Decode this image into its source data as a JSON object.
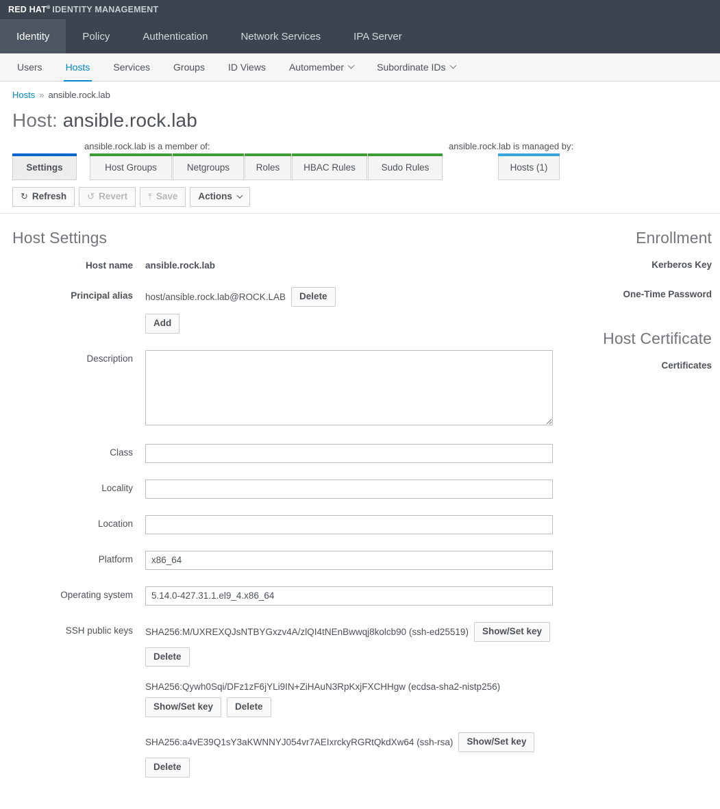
{
  "brand": {
    "vendor": "RED HAT",
    "registered": "®",
    "product": "IDENTITY MANAGEMENT"
  },
  "primary_nav": [
    {
      "label": "Identity",
      "active": true
    },
    {
      "label": "Policy",
      "active": false
    },
    {
      "label": "Authentication",
      "active": false
    },
    {
      "label": "Network Services",
      "active": false
    },
    {
      "label": "IPA Server",
      "active": false
    }
  ],
  "secondary_nav": [
    {
      "label": "Users",
      "active": false,
      "caret": false
    },
    {
      "label": "Hosts",
      "active": true,
      "caret": false
    },
    {
      "label": "Services",
      "active": false,
      "caret": false
    },
    {
      "label": "Groups",
      "active": false,
      "caret": false
    },
    {
      "label": "ID Views",
      "active": false,
      "caret": false
    },
    {
      "label": "Automember",
      "active": false,
      "caret": true
    },
    {
      "label": "Subordinate IDs",
      "active": false,
      "caret": true
    }
  ],
  "breadcrumb": {
    "root": "Hosts",
    "separator": "»",
    "current": "ansible.rock.lab"
  },
  "page_title": {
    "prefix": "Host:",
    "value": "ansible.rock.lab"
  },
  "facets": {
    "member_caption": "ansible.rock.lab is a member of:",
    "managed_caption": "ansible.rock.lab is managed by:",
    "settings_tab": "Settings",
    "member_tabs": [
      "Host Groups",
      "Netgroups",
      "Roles",
      "HBAC Rules",
      "Sudo Rules"
    ],
    "managed_tabs": [
      "Hosts (1)"
    ]
  },
  "toolbar": {
    "refresh_label": "Refresh",
    "refresh_icon": "refresh-icon",
    "revert_label": "Revert",
    "revert_icon": "undo-icon",
    "save_label": "Save",
    "save_icon": "upload-icon",
    "actions_label": "Actions"
  },
  "host_settings": {
    "title": "Host Settings",
    "host_name_label": "Host name",
    "host_name_value": "ansible.rock.lab",
    "principal_alias_label": "Principal alias",
    "principal_alias_value": "host/ansible.rock.lab@ROCK.LAB",
    "delete_label": "Delete",
    "add_label": "Add",
    "description_label": "Description",
    "description_value": "",
    "class_label": "Class",
    "class_value": "",
    "locality_label": "Locality",
    "locality_value": "",
    "location_label": "Location",
    "location_value": "",
    "platform_label": "Platform",
    "platform_value": "x86_64",
    "os_label": "Operating system",
    "os_value": "5.14.0-427.31.1.el9_4.x86_64",
    "ssh_keys_label": "SSH public keys",
    "show_set_key_label": "Show/Set key",
    "ssh_keys": [
      "SHA256:M/UXREXQJsNTBYGxzv4A/zlQI4tNEnBwwqj8kolcb90 (ssh-ed25519)",
      "SHA256:Qywh0Sqi/DFz1zF6jYLi9IN+ZiHAuN3RpKxjFXCHHgw (ecdsa-sha2-nistp256)",
      "SHA256:a4vE39Q1sY3aKWNNYJ054vr7AEIxrckyRGRtQkdXw64 (ssh-rsa)"
    ]
  },
  "enrollment": {
    "title": "Enrollment",
    "kerberos_key_label": "Kerberos Key",
    "otp_label": "One-Time Password"
  },
  "host_certificate": {
    "title": "Host Certificate",
    "certificates_label": "Certificates"
  },
  "colors": {
    "brand_bar": "#3c4450",
    "nav_active": "#4d5663",
    "link": "#0088ce",
    "tab_blue": "#0066cc",
    "tab_green": "#3f9c35",
    "tab_lightblue": "#39a5dc"
  }
}
